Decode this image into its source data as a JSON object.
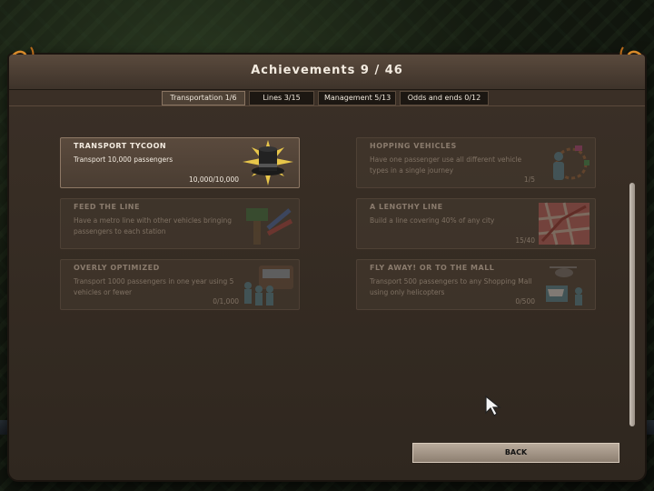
{
  "header": {
    "title": "Achievements 9 / 46"
  },
  "tabs": [
    {
      "label": "Transportation 1/6",
      "active": true
    },
    {
      "label": "Lines 3/15",
      "active": false
    },
    {
      "label": "Management 5/13",
      "active": false
    },
    {
      "label": "Odds and ends 0/12",
      "active": false
    }
  ],
  "achievements": [
    {
      "name": "TRANSPORT TYCOON",
      "description": "Transport 10,000 passengers",
      "progress": "10,000/10,000",
      "unlocked": true,
      "icon": "top-hat-icon"
    },
    {
      "name": "HOPPING VEHICLES",
      "description": "Have one passenger use all different vehicle types in a single journey",
      "progress": "1/5",
      "unlocked": false,
      "icon": "passenger-vehicles-icon"
    },
    {
      "name": "FEED THE LINE",
      "description": "Have a metro line with other vehicles bringing passengers to each station",
      "progress": "",
      "unlocked": false,
      "icon": "metro-sign-icon"
    },
    {
      "name": "A LENGTHY LINE",
      "description": "Build a line covering 40% of any city",
      "progress": "15/40",
      "unlocked": false,
      "icon": "city-map-icon"
    },
    {
      "name": "OVERLY OPTIMIZED",
      "description": "Transport 1000 passengers in one year using 5 vehicles or fewer",
      "progress": "0/1,000",
      "unlocked": false,
      "icon": "bus-passengers-icon"
    },
    {
      "name": "FLY AWAY! OR TO THE MALL",
      "description": "Transport 500 passengers to any Shopping Mall using only helicopters",
      "progress": "0/500",
      "unlocked": false,
      "icon": "helicopter-mall-icon"
    }
  ],
  "buttons": {
    "back": "BACK"
  },
  "colors": {
    "accent": "#d88a2a",
    "panel": "#3b3027",
    "button": "#b9ab9c"
  }
}
